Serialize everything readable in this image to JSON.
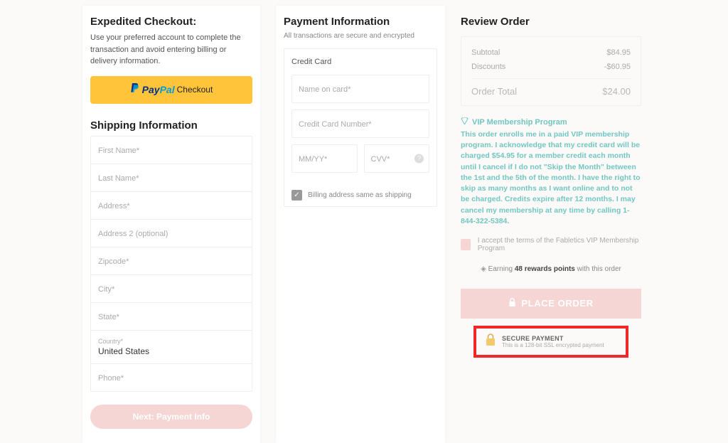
{
  "expedited": {
    "title": "Expedited Checkout:",
    "sub": "Use your preferred account to complete the transaction and avoid entering billing or delivery information.",
    "paypal_prefix1": "Pay",
    "paypal_prefix2": "Pal",
    "paypal_checkout": "Checkout"
  },
  "shipping": {
    "title": "Shipping Information",
    "fields": {
      "first": "First Name*",
      "last": "Last Name*",
      "addr": "Address*",
      "addr2": "Address 2 (optional)",
      "zip": "Zipcode*",
      "city": "City*",
      "state": "State*",
      "country_label": "Country*",
      "country_value": "United States",
      "phone": "Phone*"
    },
    "next": "Next:  Payment Info"
  },
  "payment": {
    "title": "Payment Information",
    "sub": "All transactions are secure and encrypted",
    "head": "Credit Card",
    "name": "Name on card*",
    "number": "Credit Card Number*",
    "exp": "MM/YY*",
    "cvv": "CVV*",
    "billing_same": "Billing address same as shipping"
  },
  "review": {
    "title": "Review Order",
    "subtotal_label": "Subtotal",
    "subtotal": "$84.95",
    "discounts_label": "Discounts",
    "discounts": "-$60.95",
    "total_label": "Order Total",
    "total": "$24.00",
    "vip_title": "VIP Membership Program",
    "vip_body": "This order enrolls me in a paid VIP membership program. I acknowledge that my credit card will be charged $54.95 for a member credit each month until I cancel if I do not \"Skip the Month\" between the 1st and the 5th of the month. I have the right to skip as many months as I want online and to not be charged. Credits expire after 12 months. I may cancel my membership at any time by calling 1-844-322-5384.",
    "accept": "I accept the terms of the Fabletics VIP Membership Program",
    "earning_pre": "Earning ",
    "earning_bold": "48 rewards points",
    "earning_post": " with this order",
    "place": "PLACE ORDER",
    "secure_t1": "SECURE PAYMENT",
    "secure_t2": "This is a 128-bit SSL encrypted payment"
  }
}
